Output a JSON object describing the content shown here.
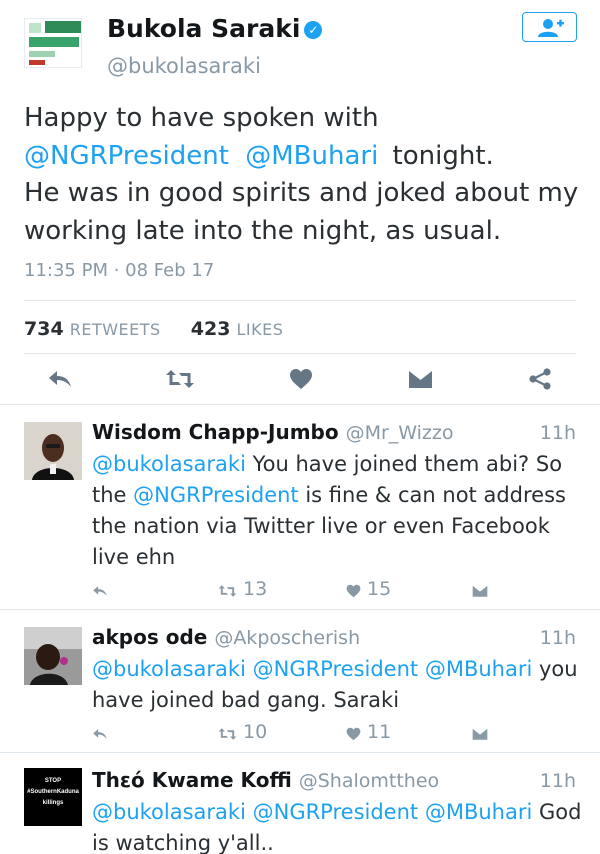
{
  "author": {
    "display_name": "Bukola Saraki",
    "handle": "@bukolasaraki",
    "verified_icon": "verified-badge-icon",
    "follow_icon": "add-user-icon"
  },
  "tweet": {
    "line1": "Happy to have spoken with",
    "mention1": "@NGRPresident",
    "mention2": "@MBuhari",
    "line2_tail": " tonight.",
    "line3": "He was in good spirits and joked about my working late into the night, as usual.",
    "timestamp": "11:35 PM · 08 Feb 17",
    "retweets": "734",
    "retweets_label": "RETWEETS",
    "likes": "423",
    "likes_label": "LIKES"
  },
  "colors": {
    "accent": "#1da1f2",
    "muted": "#8899a6",
    "icon": "#657786"
  },
  "replies": [
    {
      "name": "Wisdom Chapp-Jumbo",
      "handle": "@Mr_Wizzo",
      "time": "11h",
      "mention_a": "@bukolasaraki",
      "text_a": " You have joined them abi? So the ",
      "mention_b": "@NGRPresident",
      "text_b": " is fine & can not address the nation via Twitter live or even Facebook live ehn",
      "retweets": "13",
      "likes": "15"
    },
    {
      "name": "akpos ode",
      "handle": "@Akposcherish",
      "time": "11h",
      "mention_a": "@bukolasaraki",
      "mention_b": "@NGRPresident",
      "mention_c": "@MBuhari",
      "text_a": " you have joined bad gang. Saraki",
      "retweets": "10",
      "likes": "11"
    },
    {
      "name": "Thεό Kwame Koffi",
      "handle": "@Shalomttheo",
      "time": "11h",
      "avatar_text_1": "STOP",
      "avatar_text_2": "#SouthernKaduna",
      "avatar_text_3": "killings",
      "mention_a": "@bukolasaraki",
      "mention_b": "@NGRPresident",
      "mention_c": "@MBuhari",
      "text_a": " God is watching y'all.."
    }
  ]
}
